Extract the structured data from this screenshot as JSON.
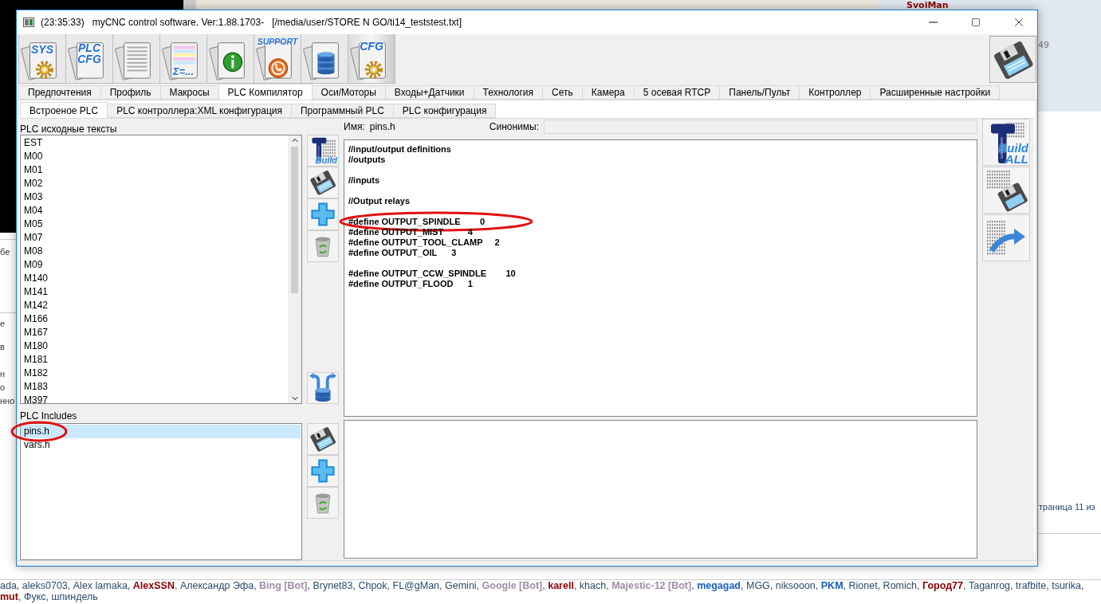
{
  "background": {
    "author": "SvoiMan",
    "post_count": "49",
    "left_fragments": [
      {
        "text": "бе"
      },
      {
        "text": "е"
      },
      {
        "text": "в"
      },
      {
        "text": "н"
      },
      {
        "text": "о"
      },
      {
        "text": "нно"
      }
    ],
    "pagination": "траница 11 из",
    "online_users": {
      "separator": ", ",
      "lines": [
        [
          {
            "name": "ada",
            "color": "#2b4a6c",
            "bold": false
          },
          {
            "name": "aleks0703",
            "color": "#2b4a6c",
            "bold": false
          },
          {
            "name": "Alex lamaka",
            "color": "#2b4a6c",
            "bold": false
          },
          {
            "name": "AlexSSN",
            "color": "#8b0000",
            "bold": true
          },
          {
            "name": "Александр Эфа",
            "color": "#2b4a6c",
            "bold": false
          },
          {
            "name": "Bing [Bot]",
            "color": "#9e8da7",
            "bold": true
          },
          {
            "name": "Brynet83",
            "color": "#2b4a6c",
            "bold": false
          },
          {
            "name": "Chpok",
            "color": "#2b4a6c",
            "bold": false
          },
          {
            "name": "FL@gMan",
            "color": "#2b4a6c",
            "bold": false
          },
          {
            "name": "Gemini",
            "color": "#2b4a6c",
            "bold": false
          },
          {
            "name": "Google [Bot]",
            "color": "#9e8da7",
            "bold": true
          },
          {
            "name": "karell",
            "color": "#8b0000",
            "bold": true
          },
          {
            "name": "khach",
            "color": "#2b4a6c",
            "bold": false
          },
          {
            "name": "Majestic-12 [Bot]",
            "color": "#9e8da7",
            "bold": true
          },
          {
            "name": "megagad",
            "color": "#1a5fc0",
            "bold": true
          },
          {
            "name": "MGG",
            "color": "#2b4a6c",
            "bold": false
          },
          {
            "name": "niksooon",
            "color": "#2b4a6c",
            "bold": false
          },
          {
            "name": "PKM",
            "color": "#1a5fc0",
            "bold": true
          },
          {
            "name": "Rionet",
            "color": "#2b4a6c",
            "bold": false
          },
          {
            "name": "Romich",
            "color": "#2b4a6c",
            "bold": false
          },
          {
            "name": "Город77",
            "color": "#8b0000",
            "bold": true
          },
          {
            "name": "Taganrog",
            "color": "#2b4a6c",
            "bold": false
          },
          {
            "name": "trafbite",
            "color": "#2b4a6c",
            "bold": false
          },
          {
            "name": "tsurika",
            "color": "#2b4a6c",
            "bold": false
          }
        ],
        [
          {
            "name": "mut",
            "color": "#8b0000",
            "bold": true
          },
          {
            "name": "Фукс",
            "color": "#2b4a6c",
            "bold": false
          },
          {
            "name": "шпиндель",
            "color": "#2b4a6c",
            "bold": false
          }
        ]
      ]
    }
  },
  "window": {
    "title": "(23:35:33)   myCNC control software. Ver:1.88.1703-   [/media/user/STORE N GO/ti14_teststest.txt]",
    "toolbar": [
      {
        "kind": "sys",
        "label": [
          "SYS"
        ]
      },
      {
        "kind": "plc-cfg",
        "label": [
          "PLC",
          "CFG"
        ]
      },
      {
        "kind": "document"
      },
      {
        "kind": "macros",
        "label": [
          "Σ=..."
        ]
      },
      {
        "kind": "info"
      },
      {
        "kind": "support",
        "label": [
          "SUPPORT"
        ]
      },
      {
        "kind": "database"
      },
      {
        "kind": "cfg",
        "label": [
          "CFG"
        ]
      }
    ],
    "tabs": [
      {
        "label": "Предпочтения",
        "selected": false
      },
      {
        "label": "Профиль",
        "selected": false
      },
      {
        "label": "Макросы",
        "selected": false
      },
      {
        "label": "PLC Компилятор",
        "selected": true
      },
      {
        "label": "Оси/Моторы",
        "selected": false
      },
      {
        "label": "Входы+Датчики",
        "selected": false
      },
      {
        "label": "Технология",
        "selected": false
      },
      {
        "label": "Сеть",
        "selected": false
      },
      {
        "label": "Камера",
        "selected": false
      },
      {
        "label": "5 осевая RTCP",
        "selected": false
      },
      {
        "label": "Панель/Пульт",
        "selected": false
      },
      {
        "label": "Контроллер",
        "selected": false
      },
      {
        "label": "Расширенные настройки",
        "selected": false
      }
    ],
    "subtabs": [
      {
        "label": "Встроеное PLC",
        "selected": true
      },
      {
        "label": "PLC контроллера:XML конфигурация",
        "selected": false
      },
      {
        "label": "Программный PLC",
        "selected": false
      },
      {
        "label": "PLC конфигурация",
        "selected": false
      }
    ],
    "sources": {
      "title": "PLC исходные тексты",
      "items": [
        {
          "label": "EST",
          "selected": false
        },
        {
          "label": "M00",
          "selected": false
        },
        {
          "label": "M01",
          "selected": false
        },
        {
          "label": "M02",
          "selected": false
        },
        {
          "label": "M03",
          "selected": false
        },
        {
          "label": "M04",
          "selected": false
        },
        {
          "label": "M05",
          "selected": false
        },
        {
          "label": "M07",
          "selected": false
        },
        {
          "label": "M08",
          "selected": false
        },
        {
          "label": "M09",
          "selected": false
        },
        {
          "label": "M140",
          "selected": false
        },
        {
          "label": "M141",
          "selected": false
        },
        {
          "label": "M142",
          "selected": false
        },
        {
          "label": "M166",
          "selected": false
        },
        {
          "label": "M167",
          "selected": false
        },
        {
          "label": "M180",
          "selected": false
        },
        {
          "label": "M181",
          "selected": false
        },
        {
          "label": "M182",
          "selected": false
        },
        {
          "label": "M183",
          "selected": false
        },
        {
          "label": "M397",
          "selected": false
        }
      ]
    },
    "includes": {
      "title": "PLC Includes",
      "items": [
        {
          "label": "pins.h",
          "selected": true,
          "circled": true
        },
        {
          "label": "vars.h",
          "selected": false,
          "circled": false
        }
      ]
    },
    "source_tools": [
      {
        "kind": "build",
        "label": "Build"
      },
      {
        "kind": "save"
      },
      {
        "kind": "add"
      },
      {
        "kind": "delete"
      }
    ],
    "source_tools_bottom": [
      {
        "kind": "sync"
      }
    ],
    "include_tools": [
      {
        "kind": "save"
      },
      {
        "kind": "add"
      },
      {
        "kind": "delete"
      }
    ],
    "right_tools": [
      {
        "kind": "build-all",
        "label": [
          "Build",
          "ALL"
        ]
      },
      {
        "kind": "save-binary"
      },
      {
        "kind": "export-binary"
      }
    ],
    "name_label": "Имя:",
    "name_value": "pins.h",
    "synonyms_label": "Синонимы:",
    "code": [
      [
        {
          "text": "//input/output definitions",
          "circled": false
        },
        {
          "text": "//outputs",
          "circled": false
        }
      ],
      [
        {
          "text": "//inputs",
          "circled": false
        }
      ],
      [
        {
          "text": "//Output relays",
          "circled": false
        }
      ],
      [
        {
          "text": "#define OUTPUT_SPINDLE        0",
          "circled": true
        },
        {
          "text": "#define OUTPUT_MIST          4",
          "circled": false
        },
        {
          "text": "#define OUTPUT_TOOL_CLAMP     2",
          "circled": false
        },
        {
          "text": "#define OUTPUT_OIL      3",
          "circled": false
        }
      ],
      [
        {
          "text": "#define OUTPUT_CCW_SPINDLE        10",
          "circled": false
        },
        {
          "text": "#define OUTPUT_FLOOD      1",
          "circled": false
        }
      ]
    ]
  }
}
